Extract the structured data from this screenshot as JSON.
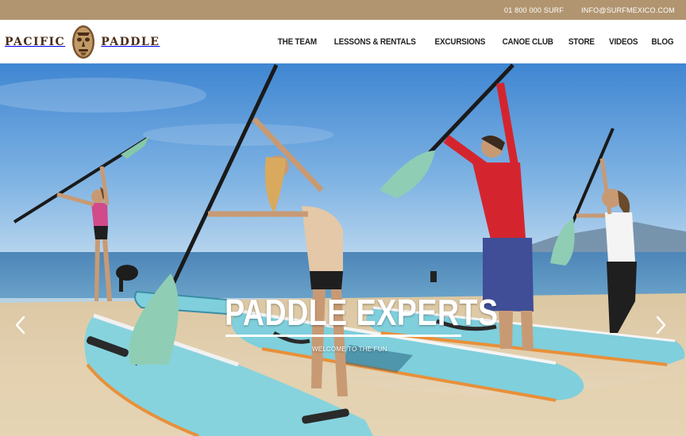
{
  "topbar": {
    "phone": "01 800 000 SURF",
    "email": "INFO@SURFMEXICO.COM"
  },
  "logo": {
    "word_left": "PACIFIC",
    "word_right": "PADDLE",
    "icon": "tiki-mask-icon"
  },
  "nav": {
    "items": [
      {
        "label": "THE TEAM"
      },
      {
        "label": "LESSONS & RENTALS"
      },
      {
        "label": "EXCURSIONS"
      },
      {
        "label": "CANOE CLUB"
      },
      {
        "label": "STORE"
      },
      {
        "label": "VIDEOS"
      },
      {
        "label": "BLOG"
      }
    ]
  },
  "hero": {
    "title": "PADDLE EXPERTS",
    "subtitle": "WELCOME TO THE FUN",
    "prev_icon": "chevron-left-icon",
    "next_icon": "chevron-right-icon"
  },
  "colors": {
    "topbar_bg": "#b19570",
    "logo_brown": "#4a2c17",
    "board_teal": "#7fd0dc",
    "board_orange": "#e8903a",
    "sky": "#6aa6dc",
    "sea": "#4f8fc0",
    "sand": "#e6d3b2"
  }
}
